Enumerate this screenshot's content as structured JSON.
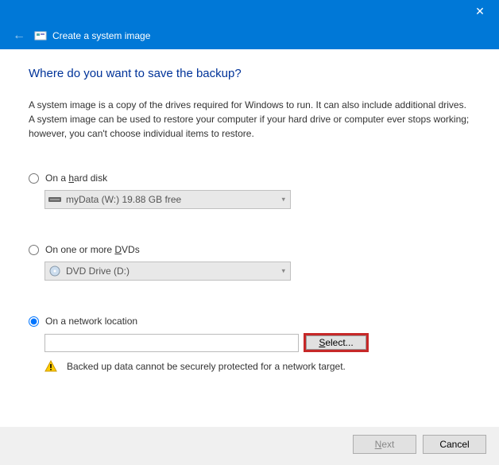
{
  "titlebar": {
    "close": "✕"
  },
  "header": {
    "title": "Create a system image"
  },
  "content": {
    "heading": "Where do you want to save the backup?",
    "description": "A system image is a copy of the drives required for Windows to run. It can also include additional drives. A system image can be used to restore your computer if your hard drive or computer ever stops working; however, you can't choose individual items to restore."
  },
  "options": {
    "harddisk": {
      "label_pre": "On a ",
      "label_u": "h",
      "label_post": "ard disk",
      "combo_text": "myData (W:)  19.88 GB free"
    },
    "dvd": {
      "label_pre": "On one or more ",
      "label_u": "D",
      "label_post": "VDs",
      "combo_text": "DVD Drive (D:)"
    },
    "network": {
      "label": "On a network location",
      "input_value": "",
      "select_button": "Select...",
      "warning": "Backed up data cannot be securely protected for a network target."
    }
  },
  "footer": {
    "next_pre": "",
    "next_u": "N",
    "next_post": "ext",
    "cancel": "Cancel"
  }
}
